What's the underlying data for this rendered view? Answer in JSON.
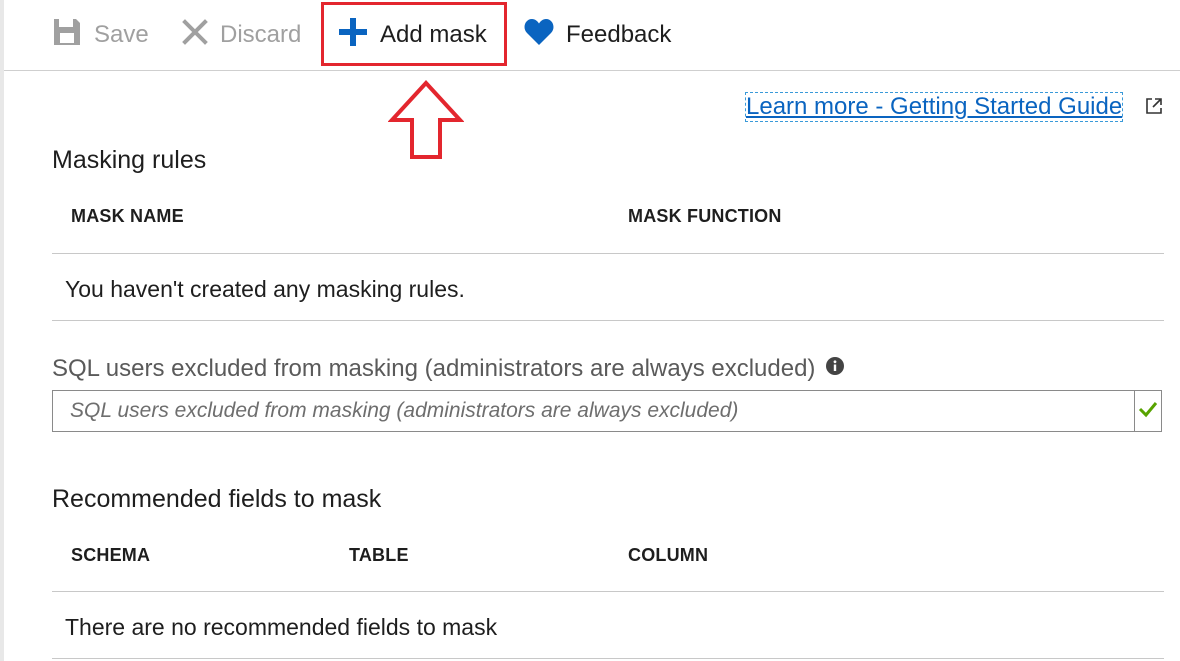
{
  "toolbar": {
    "save_label": "Save",
    "discard_label": "Discard",
    "add_mask_label": "Add mask",
    "feedback_label": "Feedback"
  },
  "learn_more": {
    "label": "Learn more - Getting Started Guide"
  },
  "masking_rules": {
    "title": "Masking rules",
    "columns": [
      "MASK NAME",
      "MASK FUNCTION"
    ],
    "empty_message": "You haven't created any masking rules."
  },
  "excluded_users": {
    "label": "SQL users excluded from masking (administrators are always excluded)",
    "placeholder": "SQL users excluded from masking (administrators are always excluded)",
    "value": ""
  },
  "recommended": {
    "title": "Recommended fields to mask",
    "columns": [
      "SCHEMA",
      "TABLE",
      "COLUMN"
    ],
    "empty_message": "There are no recommended fields to mask"
  },
  "colors": {
    "accent": "#0a64c0",
    "highlight": "#e3262e",
    "success": "#57a300",
    "disabled": "#a0a0a0"
  },
  "icons": [
    "save-icon",
    "discard-icon",
    "plus-icon",
    "heart-icon",
    "external-link-icon",
    "info-icon",
    "checkmark-icon",
    "up-arrow-annotation"
  ]
}
